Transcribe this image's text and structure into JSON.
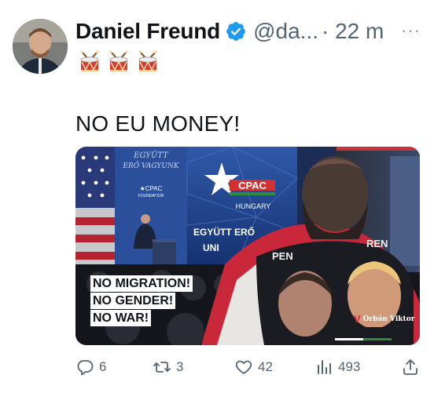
{
  "tweet": {
    "author_name": "Daniel Freund",
    "handle": "@da...",
    "time": "· 22 m",
    "more_glyph": "···",
    "emoji_line": [
      "drum",
      "drum",
      "drum"
    ],
    "text": "NO EU MONEY!",
    "verified_color": "#1d9bf0"
  },
  "media": {
    "caption_lines": [
      "NO MIGRATION!",
      "NO GENDER!",
      "NO WAR!"
    ],
    "brand": "Orbán Viktor",
    "banner_tagline_top": "EGYÜTT ERŐ VAGYUNK",
    "banner_logo_text": "CPAC FOUNDATION",
    "stage_logo": "CPAC",
    "stage_logo_sub": "HUNGARY",
    "stage_slogan": "EGYÜTT ERŐ UNI",
    "shirt_text": "PEN... REN..."
  },
  "actions": {
    "reply_count": "6",
    "retweet_count": "3",
    "like_count": "42",
    "views_count": "493",
    "icons": [
      "reply-icon",
      "retweet-icon",
      "like-icon",
      "views-icon",
      "share-icon"
    ]
  }
}
